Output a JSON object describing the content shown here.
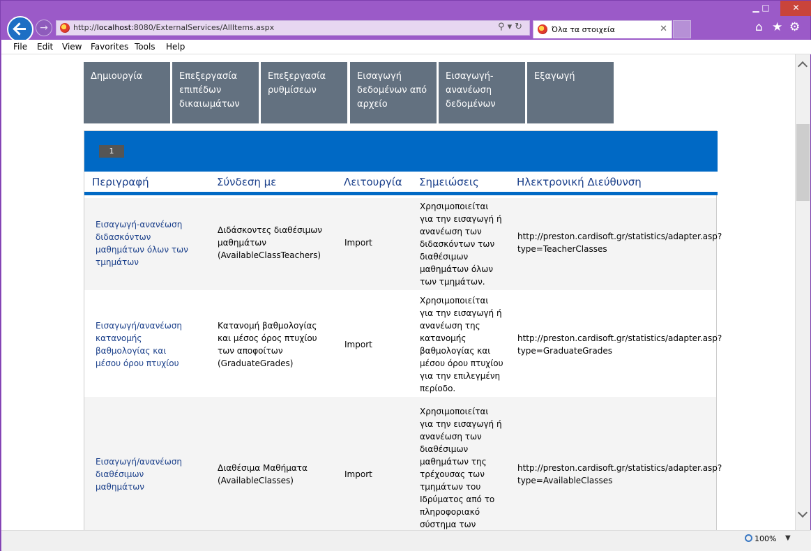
{
  "browser": {
    "url_prefix": "http://",
    "url_host": "localhost",
    "url_rest": ":8080/ExternalServices/AllItems.aspx",
    "tab_title": "Όλα τα στοιχεία",
    "menu": [
      "File",
      "Edit",
      "View",
      "Favorites",
      "Tools",
      "Help"
    ],
    "zoom": "100%"
  },
  "tiles": [
    "Δημιουργία",
    "Επεξεργασία επιπέδων δικαιωμάτων",
    "Επεξεργασία ρυθμίσεων",
    "Εισαγωγή δεδομένων από αρχείο",
    "Εισαγωγή-ανανέωση δεδομένων",
    "Εξαγωγή"
  ],
  "pager": {
    "current_page": "1"
  },
  "table": {
    "columns": [
      "Περιγραφή",
      "Σύνδεση με",
      "Λειτουργία",
      "Σημειώσεις",
      "Ηλεκτρονική Διεύθυνση"
    ],
    "rows": [
      {
        "description": "Εισαγωγή-ανανέωση διδασκόντων μαθημάτων όλων των τμημάτων",
        "link": "Διδάσκοντες διαθέσιμων μαθημάτων (AvailableClassTeachers)",
        "operation": "Import",
        "notes": "Χρησιμοποιείται για την εισαγωγή ή ανανέωση των διδασκόντων των διαθέσιμων μαθημάτων όλων των τμημάτων.",
        "address": "http://preston.cardisoft.gr/statistics/adapter.asp?type=TeacherClasses"
      },
      {
        "description": "Εισαγωγή/ανανέωση κατανομής βαθμολογίας και μέσου όρου πτυχίου",
        "link": "Κατανομή βαθμολογίας και μέσος όρος πτυχίου των αποφοίτων (GraduateGrades)",
        "operation": "Import",
        "notes": "Χρησιμοποιείται για την εισαγωγή ή ανανέωση της κατανομής βαθμολογίας και μέσου όρου πτυχίου για την επιλεγμένη περίοδο.",
        "address": "http://preston.cardisoft.gr/statistics/adapter.asp?type=GraduateGrades"
      },
      {
        "description": "Εισαγωγή/ανανέωση διαθέσιμων μαθημάτων",
        "link": "Διαθέσιμα Μαθήματα (AvailableClasses)",
        "operation": "Import",
        "notes": "Χρησιμοποιείται για την εισαγωγή ή ανανέωση των διαθέσιμων μαθημάτων της τρέχουσας των τμημάτων του Ιδρύματος από το πληροφοριακό σύστημα των Γραμματειών.",
        "address": "http://preston.cardisoft.gr/statistics/adapter.asp?type=AvailableClasses"
      }
    ]
  }
}
